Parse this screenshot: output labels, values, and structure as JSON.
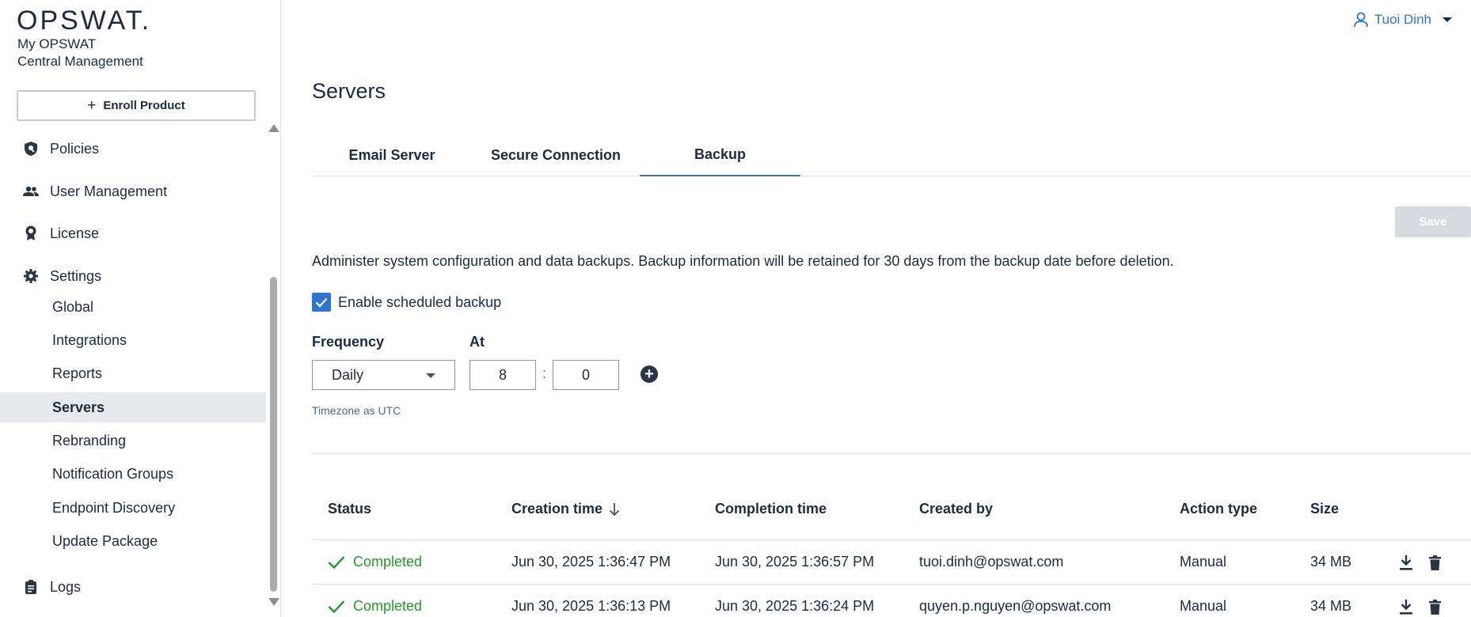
{
  "sidebar": {
    "logo": "OPSWAT.",
    "brand_line1": "My OPSWAT",
    "brand_line2": "Central Management",
    "enroll_label": "Enroll Product",
    "nav": {
      "policies": "Policies",
      "user_management": "User Management",
      "license": "License",
      "settings": "Settings",
      "logs": "Logs"
    },
    "settings_items": [
      "Global",
      "Integrations",
      "Reports",
      "Servers",
      "Rebranding",
      "Notification Groups",
      "Endpoint Discovery",
      "Update Package"
    ],
    "active_item": "Servers"
  },
  "header": {
    "user_name": "Tuoi Dinh"
  },
  "main": {
    "title": "Servers",
    "tabs": [
      "Email Server",
      "Secure Connection",
      "Backup"
    ],
    "active_tab": "Backup",
    "save_label": "Save",
    "description": "Administer system configuration and data backups. Backup information will be retained for 30 days from the backup date before deletion.",
    "enable_label": "Enable scheduled backup",
    "enable_checked": true,
    "frequency_label": "Frequency",
    "frequency_value": "Daily",
    "at_label": "At",
    "hour_value": "8",
    "minute_value": "0",
    "separator": ":",
    "timezone_note": "Timezone as UTC"
  },
  "table": {
    "columns": [
      "Status",
      "Creation time",
      "Completion time",
      "Created by",
      "Action type",
      "Size"
    ],
    "rows": [
      {
        "status": "Completed",
        "creation": "Jun 30, 2025 1:36:47 PM",
        "completion": "Jun 30, 2025 1:36:57 PM",
        "created_by": "tuoi.dinh@opswat.com",
        "action_type": "Manual",
        "size": "34 MB"
      },
      {
        "status": "Completed",
        "creation": "Jun 30, 2025 1:36:13 PM",
        "completion": "Jun 30, 2025 1:36:24 PM",
        "created_by": "quyen.p.nguyen@opswat.com",
        "action_type": "Manual",
        "size": "34 MB"
      }
    ]
  },
  "colors": {
    "accent": "#2f74d0",
    "success": "#27962f",
    "text": "#1d2b3f",
    "active_bg": "#e7e9ed",
    "save_disabled": "#d7dbe0"
  }
}
